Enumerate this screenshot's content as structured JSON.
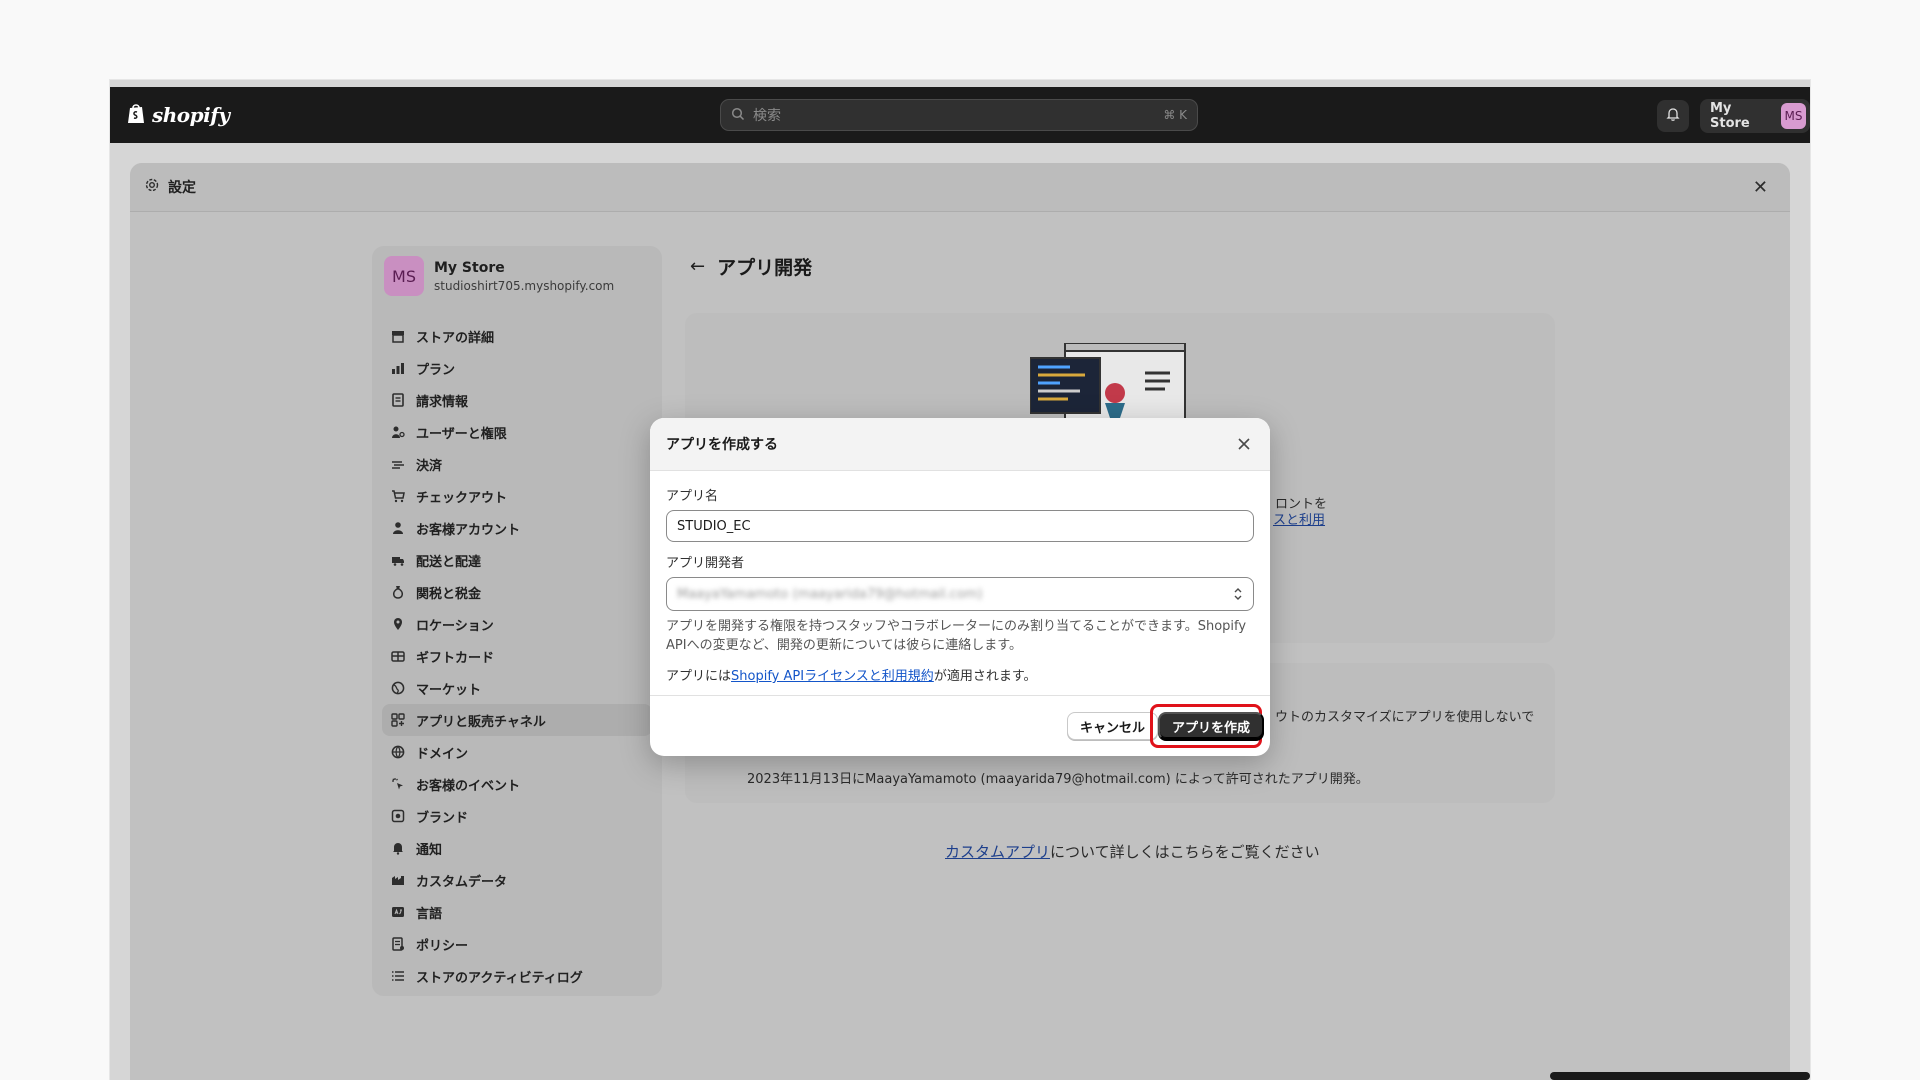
{
  "topbar": {
    "logo_text": "shopify",
    "search_placeholder": "検索",
    "search_shortcut": "⌘ K",
    "store_name": "My Store",
    "avatar_initials": "MS"
  },
  "settings": {
    "title": "設定"
  },
  "sidebar": {
    "store_name": "My Store",
    "store_domain": "studioshirt705.myshopify.com",
    "avatar_initials": "MS",
    "items": [
      {
        "label": "ストアの詳細"
      },
      {
        "label": "プラン"
      },
      {
        "label": "請求情報"
      },
      {
        "label": "ユーザーと権限"
      },
      {
        "label": "決済"
      },
      {
        "label": "チェックアウト"
      },
      {
        "label": "お客様アカウント"
      },
      {
        "label": "配送と配達"
      },
      {
        "label": "関税と税金"
      },
      {
        "label": "ロケーション"
      },
      {
        "label": "ギフトカード"
      },
      {
        "label": "マーケット"
      },
      {
        "label": "アプリと販売チャネル"
      },
      {
        "label": "ドメイン"
      },
      {
        "label": "お客様のイベント"
      },
      {
        "label": "ブランド"
      },
      {
        "label": "通知"
      },
      {
        "label": "カスタムデータ"
      },
      {
        "label": "言語"
      },
      {
        "label": "ポリシー"
      },
      {
        "label": "ストアのアクティビティログ"
      }
    ]
  },
  "main": {
    "page_title": "アプリ開発",
    "card1_partial_line1": "ロントを",
    "card1_partial_link": "スと利用",
    "card2_partial_line": "ウトのカスタマイズにアプリを使用しないで",
    "granted_text": "2023年11月13日にMaayaYamamoto (maayarida79@hotmail.com) によって許可されたアプリ開発。",
    "custom_apps_link": "カスタムアプリ",
    "custom_apps_suffix": "について詳しくはこちらをご覧ください"
  },
  "dialog": {
    "title": "アプリを作成する",
    "app_name_label": "アプリ名",
    "app_name_value": "STUDIO_EC",
    "developer_label": "アプリ開発者",
    "developer_value": "MaayaYamamoto (maayarida79@hotmail.com)",
    "help_text": "アプリを開発する権限を持つスタッフやコラボレーターにのみ割り当てることができます。Shopify APIへの変更など、開発の更新については彼らに連絡します。",
    "terms_prefix": "アプリには",
    "terms_link": "Shopify APIライセンスと利用規約",
    "terms_suffix": "が適用されます。",
    "cancel_label": "キャンセル",
    "create_label": "アプリを作成",
    "highlight_color": "#e0121a"
  }
}
